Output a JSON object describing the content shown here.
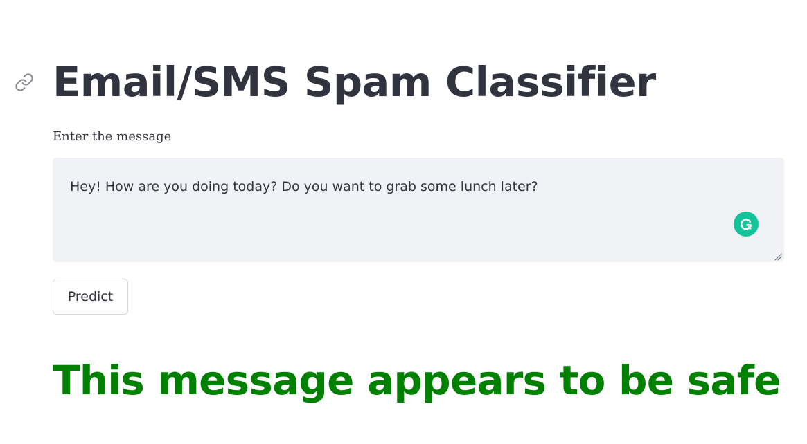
{
  "header": {
    "title": "Email/SMS Spam Classifier",
    "anchor_icon": "link-icon"
  },
  "form": {
    "label": "Enter the message",
    "message_value": "Hey! How are you doing today? Do you want to grab some lunch later?",
    "grammarly_icon": "grammarly-icon",
    "predict_label": "Predict"
  },
  "result": {
    "text": "This message appears to be safe",
    "color": "#008000"
  },
  "colors": {
    "text": "#31333f",
    "input_background": "#f0f2f6",
    "grammarly": "#15c39a"
  }
}
